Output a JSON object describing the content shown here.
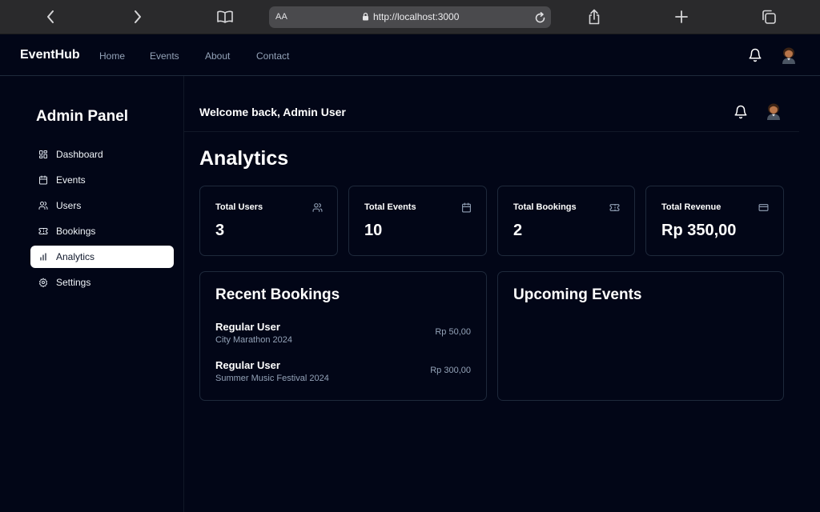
{
  "browser": {
    "reader_label": "AA",
    "url": "http://localhost:3000"
  },
  "topnav": {
    "brand": "EventHub",
    "links": [
      "Home",
      "Events",
      "About",
      "Contact"
    ]
  },
  "sidebar": {
    "title": "Admin Panel",
    "items": [
      {
        "label": "Dashboard",
        "icon": "dashboard-icon"
      },
      {
        "label": "Events",
        "icon": "calendar-icon"
      },
      {
        "label": "Users",
        "icon": "users-icon"
      },
      {
        "label": "Bookings",
        "icon": "ticket-icon"
      },
      {
        "label": "Analytics",
        "icon": "bar-chart-icon",
        "active": true
      },
      {
        "label": "Settings",
        "icon": "gear-icon"
      }
    ]
  },
  "header": {
    "welcome": "Welcome back, Admin User"
  },
  "page": {
    "title": "Analytics"
  },
  "stats": [
    {
      "label": "Total Users",
      "value": "3",
      "icon": "users-icon"
    },
    {
      "label": "Total Events",
      "value": "10",
      "icon": "calendar-icon"
    },
    {
      "label": "Total Bookings",
      "value": "2",
      "icon": "ticket-icon"
    },
    {
      "label": "Total Revenue",
      "value": "Rp 350,00",
      "icon": "credit-card-icon"
    }
  ],
  "recent_bookings": {
    "title": "Recent Bookings",
    "items": [
      {
        "user": "Regular User",
        "event": "City Marathon 2024",
        "amount": "Rp 50,00"
      },
      {
        "user": "Regular User",
        "event": "Summer Music Festival 2024",
        "amount": "Rp 300,00"
      }
    ]
  },
  "upcoming_events": {
    "title": "Upcoming Events"
  },
  "colors": {
    "background": "#020617",
    "border": "#1e293b",
    "muted_text": "#94a3b8",
    "active_item_bg": "#ffffff"
  }
}
